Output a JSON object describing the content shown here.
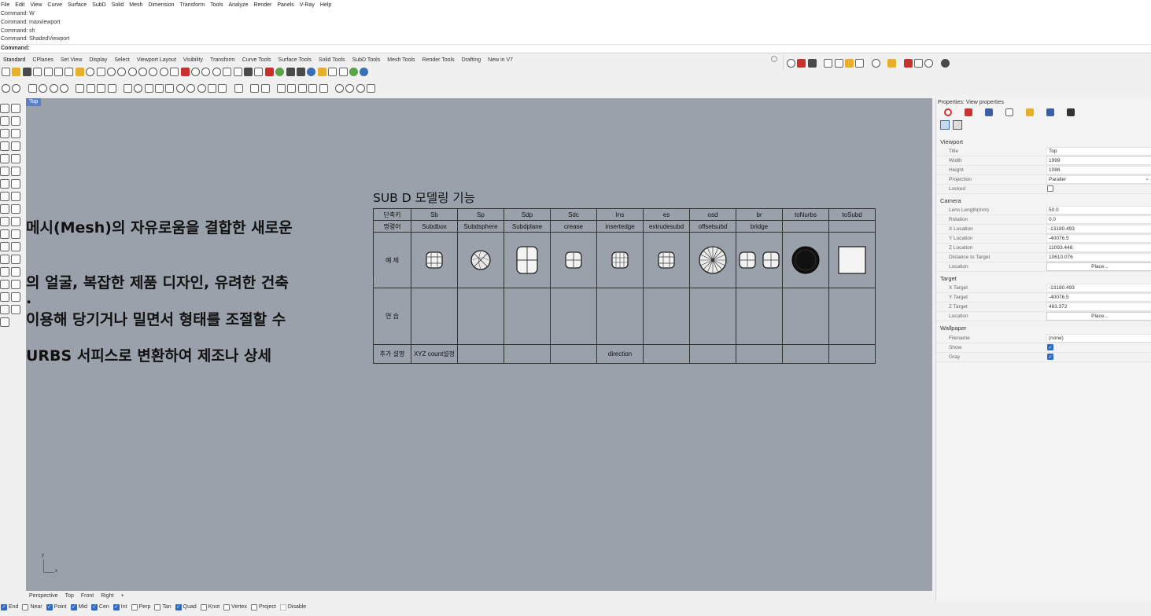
{
  "menu": [
    "File",
    "Edit",
    "View",
    "Curve",
    "Surface",
    "SubD",
    "Solid",
    "Mesh",
    "Dimension",
    "Transform",
    "Tools",
    "Analyze",
    "Render",
    "Panels",
    "V-Ray",
    "Help"
  ],
  "command_history": [
    "Command: W",
    "Command: maxviewport",
    "Command: sh",
    "Command: ShadedViewport"
  ],
  "command_prompt": "Command:",
  "toolbar_tabs": [
    "Standard",
    "CPlanes",
    "Set View",
    "Display",
    "Select",
    "Viewport Layout",
    "Visibility",
    "Transform",
    "Curve Tools",
    "Surface Tools",
    "Solid Tools",
    "SubD Tools",
    "Mesh Tools",
    "Render Tools",
    "Drafting",
    "New in V7"
  ],
  "viewport": {
    "label": "Top",
    "axis_y": "y",
    "axis_x": "x",
    "overlay_text": [
      "메시(Mesh)의 자유로움을 결합한 새로운",
      "의 얼굴, 복잡한 제품 디자인, 유려한 건축",
      ".",
      "이용해 당기거나 밀면서 형태를 조절할 수",
      "URBS 서피스로 변환하여 제조나 상세"
    ],
    "sheet_title": "SUB D 모델링 기능",
    "table": {
      "row_labels": [
        "단축키",
        "명령어",
        "예  제",
        "연  습",
        "추가 설명"
      ],
      "shortcuts": [
        "Sb",
        "Sp",
        "Sdp",
        "Sdc",
        "Ins",
        "es",
        "osd",
        "br",
        "toNurbs",
        "toSubd"
      ],
      "commands": [
        "Subdbox",
        "Subdsphere",
        "Subdplane",
        "crease",
        "insertedge",
        "extrudesubd",
        "offsetsubd",
        "bridge",
        "",
        ""
      ],
      "notes": [
        "XYZ count설정",
        "",
        "",
        "",
        "direction",
        "",
        "",
        "",
        "",
        ""
      ]
    }
  },
  "viewport_tabs": [
    "Perspective",
    "Top",
    "Front",
    "Right",
    "+"
  ],
  "osnaps": [
    {
      "label": "End",
      "on": true
    },
    {
      "label": "Near",
      "on": false
    },
    {
      "label": "Point",
      "on": true
    },
    {
      "label": "Mid",
      "on": true
    },
    {
      "label": "Cen",
      "on": true
    },
    {
      "label": "Int",
      "on": true
    },
    {
      "label": "Perp",
      "on": false
    },
    {
      "label": "Tan",
      "on": false
    },
    {
      "label": "Quad",
      "on": true
    },
    {
      "label": "Knot",
      "on": false
    },
    {
      "label": "Vertex",
      "on": false
    },
    {
      "label": "Project",
      "on": false
    },
    {
      "label": "Disable",
      "on": false
    }
  ],
  "properties": {
    "title": "Properties: View properties",
    "sections": {
      "viewport": "Viewport",
      "camera": "Camera",
      "target": "Target",
      "wallpaper": "Wallpaper"
    },
    "viewport_rows": [
      {
        "key": "Title",
        "value": "Top"
      },
      {
        "key": "Width",
        "value": "1999"
      },
      {
        "key": "Height",
        "value": "1086"
      },
      {
        "key": "Projection",
        "value": "Parallel"
      },
      {
        "key": "Locked",
        "value": ""
      }
    ],
    "camera_rows": [
      {
        "key": "Lens Length(mm)",
        "value": "50.0"
      },
      {
        "key": "Rotation",
        "value": "0.0"
      },
      {
        "key": "X Location",
        "value": "-13180.493"
      },
      {
        "key": "Y Location",
        "value": "-40076.5"
      },
      {
        "key": "Z Location",
        "value": "11093.448"
      },
      {
        "key": "Distance to Target",
        "value": "10610.076"
      },
      {
        "key": "Location",
        "value": "Place..."
      }
    ],
    "target_rows": [
      {
        "key": "X Target",
        "value": "-13180.493"
      },
      {
        "key": "Y Target",
        "value": "-40076.5"
      },
      {
        "key": "Z Target",
        "value": "483.372"
      },
      {
        "key": "Location",
        "value": "Place..."
      }
    ],
    "wallpaper_rows": [
      {
        "key": "Filename",
        "value": "(none)"
      },
      {
        "key": "Show",
        "value": ""
      },
      {
        "key": "Gray",
        "value": ""
      }
    ]
  }
}
